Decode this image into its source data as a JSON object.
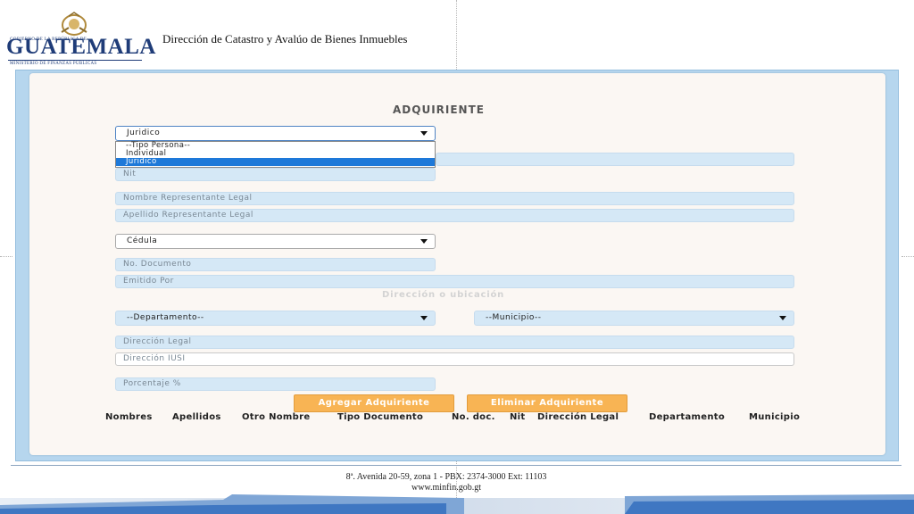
{
  "header": {
    "logo": {
      "line1": "GOBIERNO DE LA REPÚBLICA DE",
      "big": "GUATEMALA",
      "line2": "MINISTERIO DE FINANZAS PÚBLICAS"
    },
    "title": "Dirección de Catastro y Avalúo de Bienes Inmuebles"
  },
  "form": {
    "section_title": "ADQUIRIENTE",
    "tipo_persona": {
      "selected": "Juridico",
      "options": [
        "--Tipo Persona--",
        "Individual",
        "Juridico"
      ]
    },
    "nit_placeholder": "Nit",
    "nombre_rep_placeholder": "Nombre Representante Legal",
    "apellido_rep_placeholder": "Apellido Representante Legal",
    "documento_select": "Cédula",
    "no_documento_placeholder": "No. Documento",
    "emitido_por_placeholder": "Emitido Por",
    "direccion_section": "Dirección o ubicación",
    "departamento_select": "--Departamento--",
    "municipio_select": "--Municipio--",
    "direccion_legal_placeholder": "Dirección Legal",
    "direccion_iusi_placeholder": "Dirección IUSI",
    "porcentaje_placeholder": "Porcentaje %",
    "agregar_button": "Agregar Adquiriente",
    "eliminar_button": "Eliminar Adquiriente"
  },
  "table": {
    "headers": [
      "Nombres",
      "Apellidos",
      "Otro Nombre",
      "Tipo Documento",
      "No. doc.",
      "Nit",
      "Dirección Legal",
      "Departamento",
      "Municipio"
    ]
  },
  "footer": {
    "address": "8ª. Avenida 20-59, zona 1 -  PBX: 2374-3000  Ext: 11103",
    "url": "www.minfin.gob.gt"
  },
  "colors": {
    "brand_blue": "#1f3c78",
    "field_blue": "#d5e8f6",
    "button_orange": "#f8b454",
    "selection_blue": "#1e79d9"
  }
}
